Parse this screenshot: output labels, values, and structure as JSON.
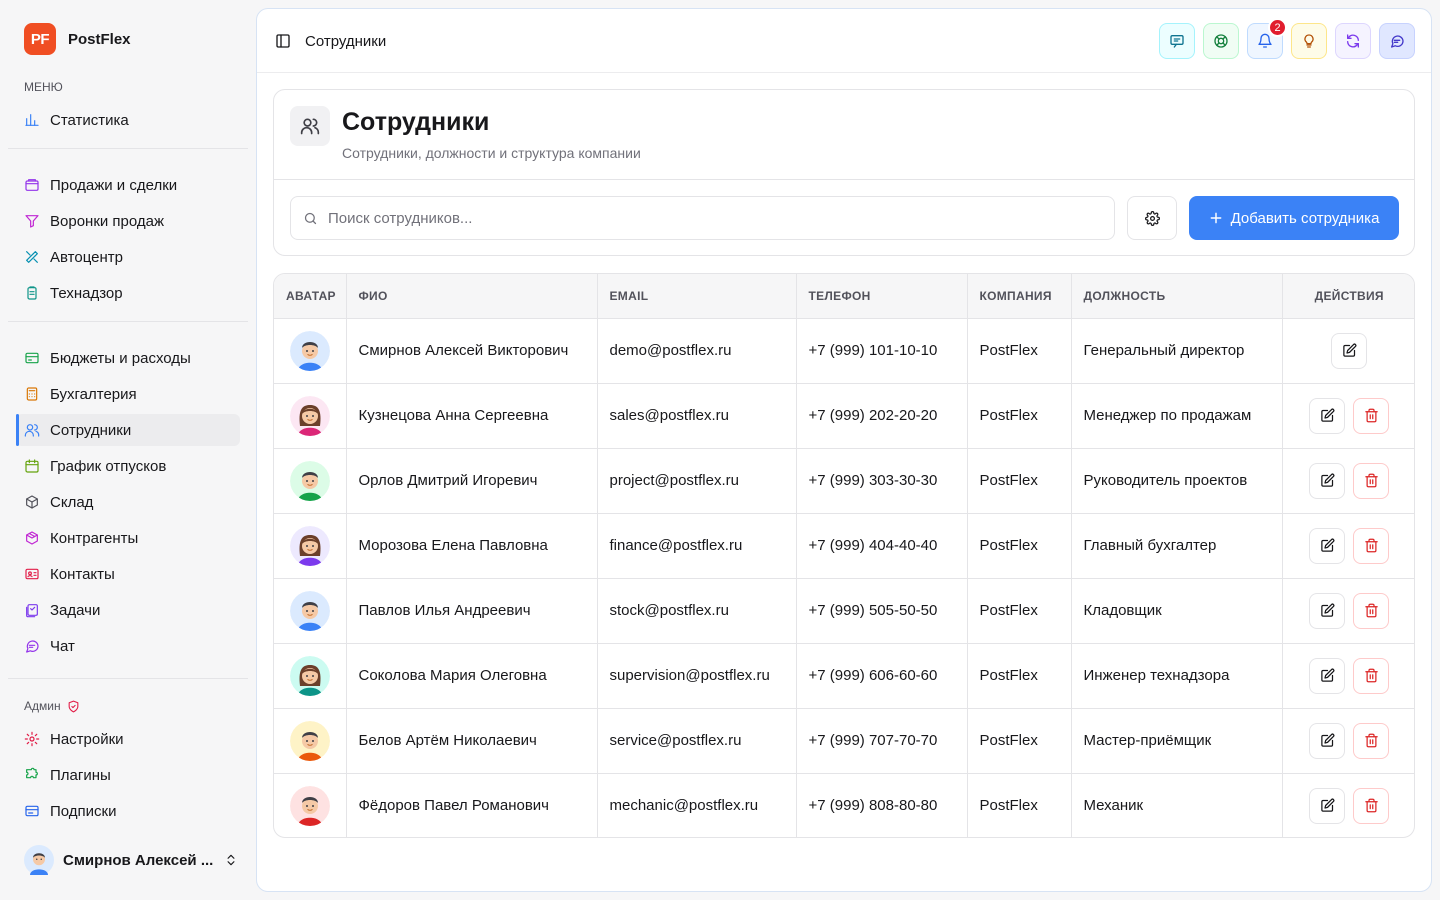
{
  "app": {
    "logo": "PF",
    "name": "PostFlex"
  },
  "sidebar": {
    "menu_caption": "МЕНЮ",
    "admin_caption": "Админ",
    "groups": [
      [
        {
          "label": "Статистика",
          "icon": "bar-chart-icon",
          "color": "#3b82f6"
        }
      ],
      [
        {
          "label": "Продажи и сделки",
          "icon": "wallet-icon",
          "color": "#9333ea"
        },
        {
          "label": "Воронки продаж",
          "icon": "funnel-icon",
          "color": "#c026d3"
        },
        {
          "label": "Автоцентр",
          "icon": "wrench-icon",
          "color": "#0891b2"
        },
        {
          "label": "Технадзор",
          "icon": "clipboard-icon",
          "color": "#0d9488"
        }
      ],
      [
        {
          "label": "Бюджеты и расходы",
          "icon": "card-icon",
          "color": "#16a34a"
        },
        {
          "label": "Бухгалтерия",
          "icon": "calculator-icon",
          "color": "#d97706"
        },
        {
          "label": "Сотрудники",
          "icon": "users-icon",
          "color": "#3b82f6",
          "active": true
        },
        {
          "label": "График отпусков",
          "icon": "calendar-icon",
          "color": "#65a30d"
        },
        {
          "label": "Склад",
          "icon": "box-icon",
          "color": "#52525b"
        },
        {
          "label": "Контрагенты",
          "icon": "package-icon",
          "color": "#c026d3"
        },
        {
          "label": "Контакты",
          "icon": "contact-card-icon",
          "color": "#e11d48"
        },
        {
          "label": "Задачи",
          "icon": "tasks-icon",
          "color": "#7c3aed"
        },
        {
          "label": "Чат",
          "icon": "chat-icon",
          "color": "#9333ea"
        }
      ],
      [
        {
          "label": "Настройки",
          "icon": "gear-icon",
          "color": "#e11d48"
        },
        {
          "label": "Плагины",
          "icon": "puzzle-icon",
          "color": "#16a34a"
        },
        {
          "label": "Подписки",
          "icon": "subscription-card-icon",
          "color": "#2563eb"
        }
      ]
    ],
    "user_name": "Смирнов Алексей ..."
  },
  "topbar": {
    "breadcrumb": "Сотрудники",
    "notifications_count": "2",
    "buttons": [
      {
        "name": "feedback-button",
        "icon": "message-square-icon",
        "color": "#0e7490",
        "bg": "#ecfeff",
        "border": "#a5f3fc"
      },
      {
        "name": "support-button",
        "icon": "lifebuoy-icon",
        "color": "#15803d",
        "bg": "#f0fdf4",
        "border": "#bbf7d0"
      },
      {
        "name": "notifications-button",
        "icon": "bell-icon",
        "color": "#2563eb",
        "bg": "#eff6ff",
        "border": "#bfdbfe"
      },
      {
        "name": "tips-button",
        "icon": "lightbulb-icon",
        "color": "#b45309",
        "bg": "#fefce8",
        "border": "#fde68a"
      },
      {
        "name": "refresh-button",
        "icon": "refresh-icon",
        "color": "#7c3aed",
        "bg": "#f5f3ff",
        "border": "#ddd6fe"
      },
      {
        "name": "chat-button",
        "icon": "chat-icon",
        "color": "#4338ca",
        "bg": "#e0e7ff",
        "border": "#c7d2fe"
      }
    ]
  },
  "page": {
    "title": "Сотрудники",
    "subtitle": "Сотрудники, должности и структура компании",
    "search_placeholder": "Поиск сотрудников...",
    "add_label": "Добавить сотрудника"
  },
  "table": {
    "columns": [
      "АВАТАР",
      "ФИО",
      "EMAIL",
      "ТЕЛЕФОН",
      "КОМПАНИЯ",
      "ДОЛЖНОСТЬ",
      "ДЕЙСТВИЯ"
    ],
    "rows": [
      {
        "name": "Смирнов Алексей Викторович",
        "email": "demo@postflex.ru",
        "phone": "+7 (999) 101-10-10",
        "company": "PostFlex",
        "position": "Генеральный директор",
        "can_delete": false,
        "avatar": {
          "bg": "#dbeafe",
          "shirt": "#3b82f6",
          "hair": "#3f3f46",
          "female": false
        }
      },
      {
        "name": "Кузнецова Анна Сергеевна",
        "email": "sales@postflex.ru",
        "phone": "+7 (999) 202-20-20",
        "company": "PostFlex",
        "position": "Менеджер по продажам",
        "can_delete": true,
        "avatar": {
          "bg": "#fce7f3",
          "shirt": "#db2777",
          "hair": "#6b3f2a",
          "female": true
        }
      },
      {
        "name": "Орлов Дмитрий Игоревич",
        "email": "project@postflex.ru",
        "phone": "+7 (999) 303-30-30",
        "company": "PostFlex",
        "position": "Руководитель проектов",
        "can_delete": true,
        "avatar": {
          "bg": "#dcfce7",
          "shirt": "#16a34a",
          "hair": "#3f3f46",
          "female": false
        }
      },
      {
        "name": "Морозова Елена Павловна",
        "email": "finance@postflex.ru",
        "phone": "+7 (999) 404-40-40",
        "company": "PostFlex",
        "position": "Главный бухгалтер",
        "can_delete": true,
        "avatar": {
          "bg": "#ede9fe",
          "shirt": "#7c3aed",
          "hair": "#6b3f2a",
          "female": true
        }
      },
      {
        "name": "Павлов Илья Андреевич",
        "email": "stock@postflex.ru",
        "phone": "+7 (999) 505-50-50",
        "company": "PostFlex",
        "position": "Кладовщик",
        "can_delete": true,
        "avatar": {
          "bg": "#dbeafe",
          "shirt": "#3b82f6",
          "hair": "#3f3f46",
          "female": false
        }
      },
      {
        "name": "Соколова Мария Олеговна",
        "email": "supervision@postflex.ru",
        "phone": "+7 (999) 606-60-60",
        "company": "PostFlex",
        "position": "Инженер технадзора",
        "can_delete": true,
        "avatar": {
          "bg": "#ccfbf1",
          "shirt": "#0d9488",
          "hair": "#6b3f2a",
          "female": true
        }
      },
      {
        "name": "Белов Артём Николаевич",
        "email": "service@postflex.ru",
        "phone": "+7 (999) 707-70-70",
        "company": "PostFlex",
        "position": "Мастер-приёмщик",
        "can_delete": true,
        "avatar": {
          "bg": "#fef3c7",
          "shirt": "#ea580c",
          "hair": "#3f3f46",
          "female": false
        }
      },
      {
        "name": "Фёдоров Павел Романович",
        "email": "mechanic@postflex.ru",
        "phone": "+7 (999) 808-80-80",
        "company": "PostFlex",
        "position": "Механик",
        "can_delete": true,
        "avatar": {
          "bg": "#fee2e2",
          "shirt": "#dc2626",
          "hair": "#3f3f46",
          "female": false
        }
      }
    ]
  },
  "colors": {
    "accent": "#3b82f6",
    "brand": "#f04e23",
    "danger": "#dc2626"
  }
}
